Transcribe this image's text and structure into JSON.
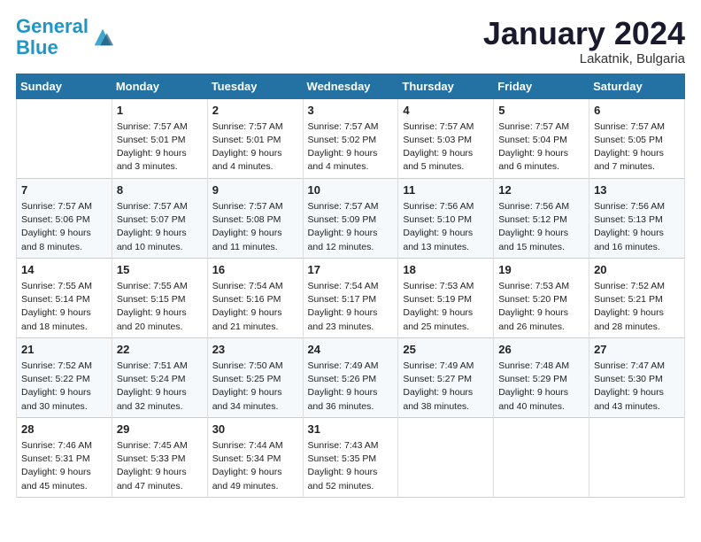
{
  "header": {
    "logo_line1": "General",
    "logo_line2": "Blue",
    "month": "January 2024",
    "location": "Lakatnik, Bulgaria"
  },
  "columns": [
    "Sunday",
    "Monday",
    "Tuesday",
    "Wednesday",
    "Thursday",
    "Friday",
    "Saturday"
  ],
  "weeks": [
    [
      {
        "day": "",
        "content": ""
      },
      {
        "day": "1",
        "content": "Sunrise: 7:57 AM\nSunset: 5:01 PM\nDaylight: 9 hours\nand 3 minutes."
      },
      {
        "day": "2",
        "content": "Sunrise: 7:57 AM\nSunset: 5:01 PM\nDaylight: 9 hours\nand 4 minutes."
      },
      {
        "day": "3",
        "content": "Sunrise: 7:57 AM\nSunset: 5:02 PM\nDaylight: 9 hours\nand 4 minutes."
      },
      {
        "day": "4",
        "content": "Sunrise: 7:57 AM\nSunset: 5:03 PM\nDaylight: 9 hours\nand 5 minutes."
      },
      {
        "day": "5",
        "content": "Sunrise: 7:57 AM\nSunset: 5:04 PM\nDaylight: 9 hours\nand 6 minutes."
      },
      {
        "day": "6",
        "content": "Sunrise: 7:57 AM\nSunset: 5:05 PM\nDaylight: 9 hours\nand 7 minutes."
      }
    ],
    [
      {
        "day": "7",
        "content": "Sunrise: 7:57 AM\nSunset: 5:06 PM\nDaylight: 9 hours\nand 8 minutes."
      },
      {
        "day": "8",
        "content": "Sunrise: 7:57 AM\nSunset: 5:07 PM\nDaylight: 9 hours\nand 10 minutes."
      },
      {
        "day": "9",
        "content": "Sunrise: 7:57 AM\nSunset: 5:08 PM\nDaylight: 9 hours\nand 11 minutes."
      },
      {
        "day": "10",
        "content": "Sunrise: 7:57 AM\nSunset: 5:09 PM\nDaylight: 9 hours\nand 12 minutes."
      },
      {
        "day": "11",
        "content": "Sunrise: 7:56 AM\nSunset: 5:10 PM\nDaylight: 9 hours\nand 13 minutes."
      },
      {
        "day": "12",
        "content": "Sunrise: 7:56 AM\nSunset: 5:12 PM\nDaylight: 9 hours\nand 15 minutes."
      },
      {
        "day": "13",
        "content": "Sunrise: 7:56 AM\nSunset: 5:13 PM\nDaylight: 9 hours\nand 16 minutes."
      }
    ],
    [
      {
        "day": "14",
        "content": "Sunrise: 7:55 AM\nSunset: 5:14 PM\nDaylight: 9 hours\nand 18 minutes."
      },
      {
        "day": "15",
        "content": "Sunrise: 7:55 AM\nSunset: 5:15 PM\nDaylight: 9 hours\nand 20 minutes."
      },
      {
        "day": "16",
        "content": "Sunrise: 7:54 AM\nSunset: 5:16 PM\nDaylight: 9 hours\nand 21 minutes."
      },
      {
        "day": "17",
        "content": "Sunrise: 7:54 AM\nSunset: 5:17 PM\nDaylight: 9 hours\nand 23 minutes."
      },
      {
        "day": "18",
        "content": "Sunrise: 7:53 AM\nSunset: 5:19 PM\nDaylight: 9 hours\nand 25 minutes."
      },
      {
        "day": "19",
        "content": "Sunrise: 7:53 AM\nSunset: 5:20 PM\nDaylight: 9 hours\nand 26 minutes."
      },
      {
        "day": "20",
        "content": "Sunrise: 7:52 AM\nSunset: 5:21 PM\nDaylight: 9 hours\nand 28 minutes."
      }
    ],
    [
      {
        "day": "21",
        "content": "Sunrise: 7:52 AM\nSunset: 5:22 PM\nDaylight: 9 hours\nand 30 minutes."
      },
      {
        "day": "22",
        "content": "Sunrise: 7:51 AM\nSunset: 5:24 PM\nDaylight: 9 hours\nand 32 minutes."
      },
      {
        "day": "23",
        "content": "Sunrise: 7:50 AM\nSunset: 5:25 PM\nDaylight: 9 hours\nand 34 minutes."
      },
      {
        "day": "24",
        "content": "Sunrise: 7:49 AM\nSunset: 5:26 PM\nDaylight: 9 hours\nand 36 minutes."
      },
      {
        "day": "25",
        "content": "Sunrise: 7:49 AM\nSunset: 5:27 PM\nDaylight: 9 hours\nand 38 minutes."
      },
      {
        "day": "26",
        "content": "Sunrise: 7:48 AM\nSunset: 5:29 PM\nDaylight: 9 hours\nand 40 minutes."
      },
      {
        "day": "27",
        "content": "Sunrise: 7:47 AM\nSunset: 5:30 PM\nDaylight: 9 hours\nand 43 minutes."
      }
    ],
    [
      {
        "day": "28",
        "content": "Sunrise: 7:46 AM\nSunset: 5:31 PM\nDaylight: 9 hours\nand 45 minutes."
      },
      {
        "day": "29",
        "content": "Sunrise: 7:45 AM\nSunset: 5:33 PM\nDaylight: 9 hours\nand 47 minutes."
      },
      {
        "day": "30",
        "content": "Sunrise: 7:44 AM\nSunset: 5:34 PM\nDaylight: 9 hours\nand 49 minutes."
      },
      {
        "day": "31",
        "content": "Sunrise: 7:43 AM\nSunset: 5:35 PM\nDaylight: 9 hours\nand 52 minutes."
      },
      {
        "day": "",
        "content": ""
      },
      {
        "day": "",
        "content": ""
      },
      {
        "day": "",
        "content": ""
      }
    ]
  ]
}
